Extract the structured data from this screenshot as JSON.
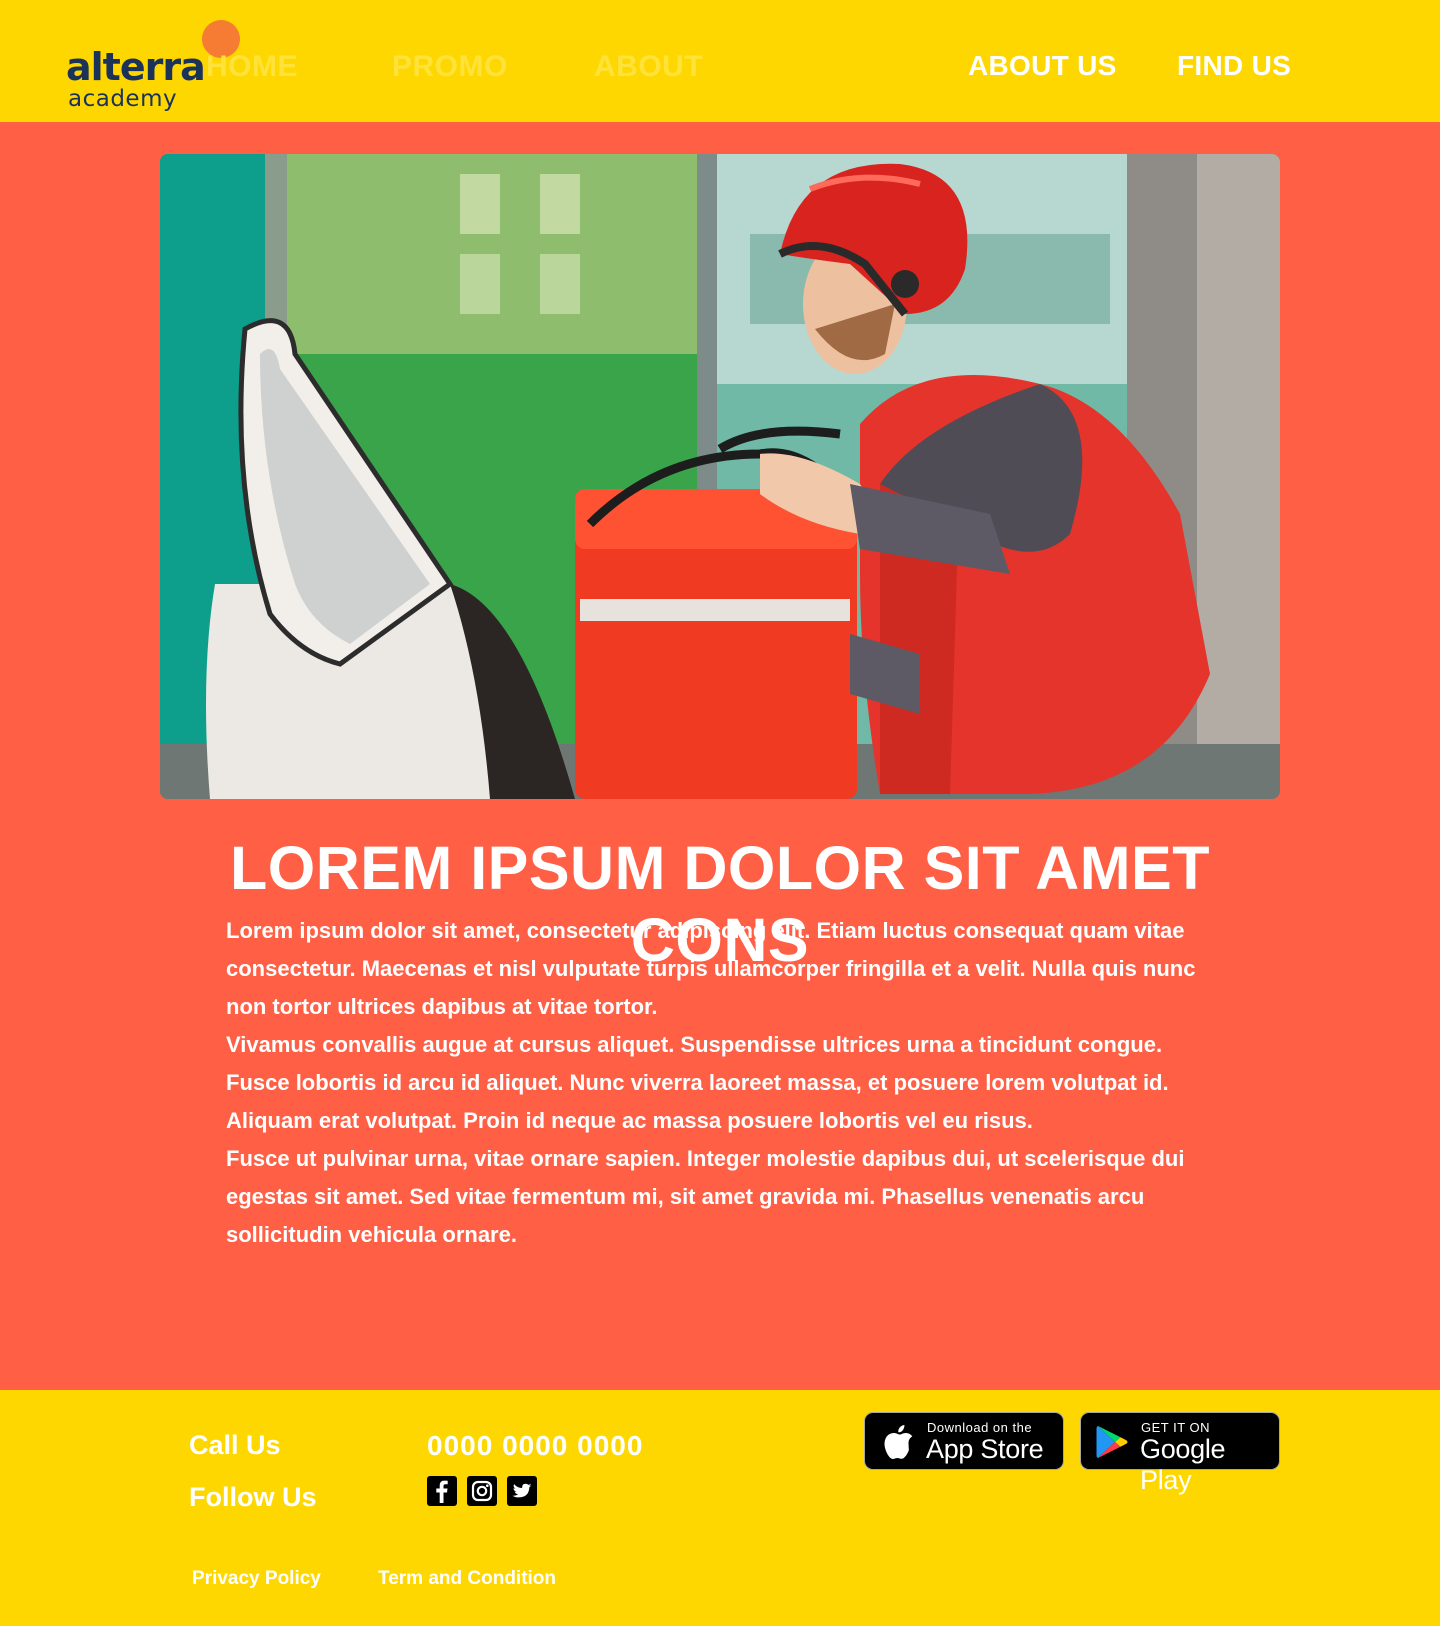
{
  "header": {
    "logo": {
      "word": "alterra",
      "sub": "academy"
    },
    "ghost_nav": [
      "HOME",
      "PROMO",
      "ABOUT"
    ],
    "nav": {
      "about": "ABOUT US",
      "find": "FIND US"
    }
  },
  "hero": {
    "icon": "delivery-photo"
  },
  "article": {
    "title": "LOREM IPSUM DOLOR SIT AMET CONS",
    "paragraphs": [
      "Lorem ipsum dolor sit amet, consectetur adipiscing elit. Etiam luctus consequat quam vitae consectetur. Maecenas et nisl vulputate turpis ullamcorper fringilla et a velit. Nulla quis nunc non tortor ultrices dapibus at vitae tortor.",
      "Vivamus convallis augue at cursus aliquet. Suspendisse ultrices urna a tincidunt congue. Fusce lobortis id arcu id aliquet. Nunc viverra laoreet massa, et posuere lorem volutpat id. Aliquam erat volutpat. Proin id neque ac massa posuere lobortis vel eu risus.",
      "Fusce ut pulvinar urna, vitae ornare sapien. Integer molestie dapibus dui, ut scelerisque dui egestas sit amet. Sed vitae fermentum mi, sit amet gravida mi. Phasellus venenatis arcu sollicitudin vehicula ornare."
    ]
  },
  "footer": {
    "call_label": "Call Us",
    "phone": "0000 0000 0000",
    "follow_label": "Follow Us",
    "social": [
      "facebook-icon",
      "instagram-icon",
      "twitter-icon"
    ],
    "app_store": {
      "small": "Download on the",
      "big": "App Store"
    },
    "google_play": {
      "small": "GET IT ON",
      "big": "Google Play"
    },
    "links": {
      "privacy": "Privacy Policy",
      "terms": "Term and Condition"
    }
  },
  "colors": {
    "yellow": "#ffd700",
    "coral": "#ff5f45",
    "logo_navy": "#1b3358",
    "logo_orange": "#f57c32"
  }
}
